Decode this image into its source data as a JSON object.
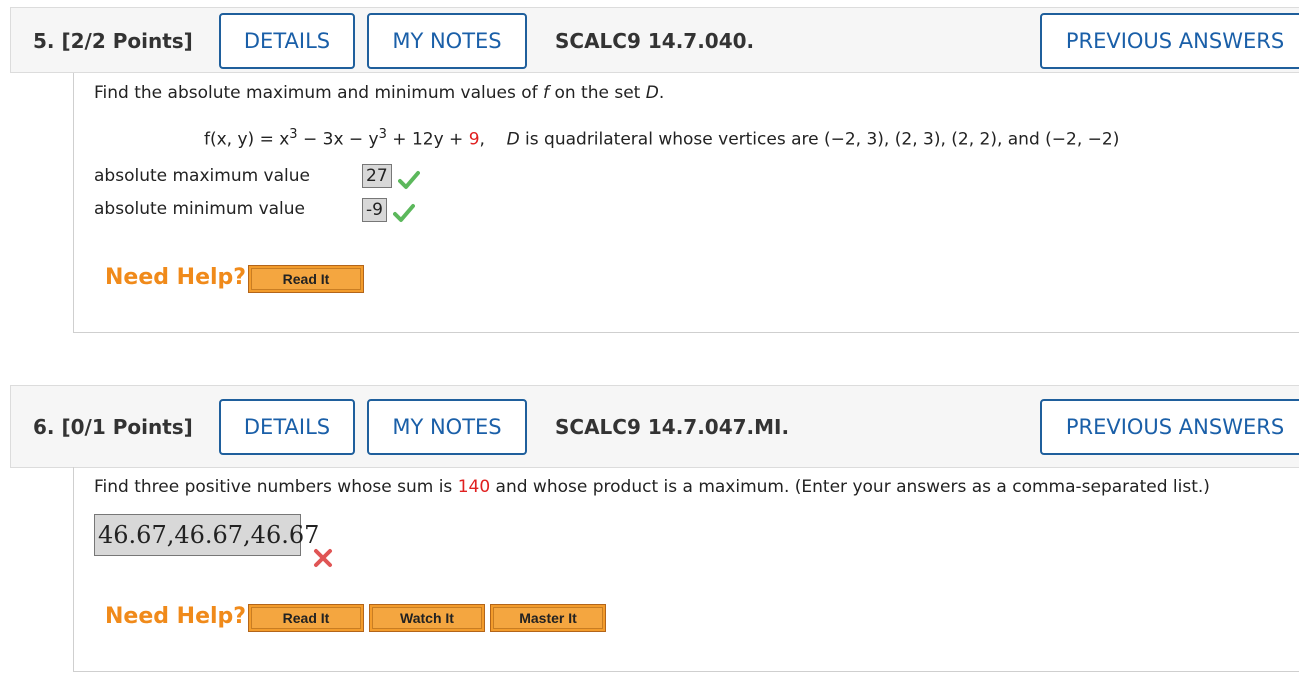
{
  "questions": [
    {
      "number_label": "5.",
      "points_label": "[2/2 Points]",
      "details_label": "DETAILS",
      "my_notes_label": "MY NOTES",
      "code": "SCALC9 14.7.040.",
      "previous_answers_label": "PREVIOUS ANSWERS",
      "prompt": {
        "text_before_f": "Find the absolute maximum and minimum values of ",
        "f": "f",
        "text_middle": " on the set ",
        "D": "D",
        "text_end": "."
      },
      "formula": {
        "lhs": "f(x, y) = x",
        "exp1": "3",
        "part2": " − 3x − y",
        "exp2": "3",
        "part3": " + 12y + ",
        "constant": "9",
        "part4": ",    ",
        "D": "D",
        "domain_text": " is quadrilateral whose vertices are (−2, 3), (2, 3), (2, 2), and (−2, −2)"
      },
      "answers": [
        {
          "label": "absolute maximum value",
          "value": "27",
          "status": "correct"
        },
        {
          "label": "absolute minimum value",
          "value": "-9",
          "status": "correct"
        }
      ],
      "need_help_label": "Need Help?",
      "help_buttons": [
        "Read It"
      ]
    },
    {
      "number_label": "6.",
      "points_label": "[0/1 Points]",
      "details_label": "DETAILS",
      "my_notes_label": "MY NOTES",
      "code": "SCALC9 14.7.047.MI.",
      "previous_answers_label": "PREVIOUS ANSWERS",
      "prompt": {
        "text_before": "Find three positive numbers whose sum is ",
        "highlight": "140",
        "text_after": " and whose product is a maximum. (Enter your answers as a comma-separated list.)"
      },
      "answer_value": "46.67,46.67,46.67",
      "answer_status": "incorrect",
      "need_help_label": "Need Help?",
      "help_buttons": [
        "Read It",
        "Watch It",
        "Master It"
      ]
    }
  ],
  "colors": {
    "link_blue": "#1a5fa8",
    "help_orange": "#f08a1a",
    "button_orange": "#f39c2c",
    "highlight_red": "#e02020",
    "check_green": "#5cb85c",
    "x_red": "#e05555"
  }
}
